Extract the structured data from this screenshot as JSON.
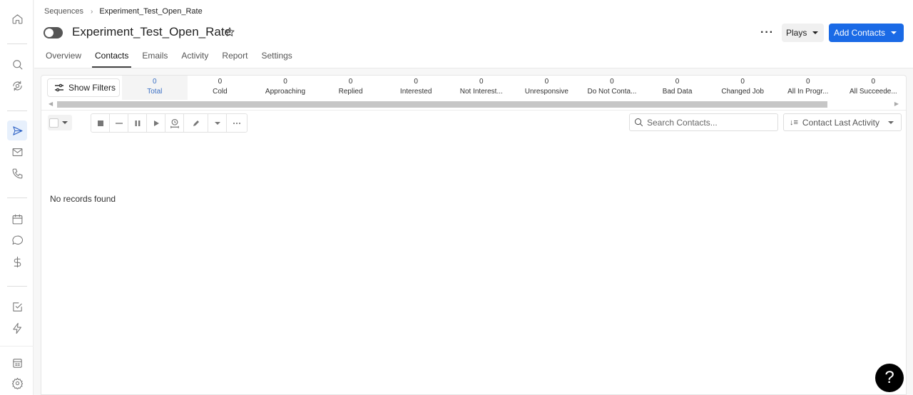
{
  "sidebar": {
    "items": [
      {
        "name": "home",
        "icon": "home-icon"
      },
      {
        "name": "search",
        "icon": "search-icon"
      },
      {
        "name": "sync",
        "icon": "sync-icon"
      },
      {
        "name": "sequences",
        "icon": "send-icon",
        "active": true
      },
      {
        "name": "mail",
        "icon": "mail-icon"
      },
      {
        "name": "phone",
        "icon": "phone-icon"
      },
      {
        "name": "calendar",
        "icon": "calendar-icon"
      },
      {
        "name": "chat",
        "icon": "chat-icon"
      },
      {
        "name": "deals",
        "icon": "dollar-icon"
      },
      {
        "name": "tasks",
        "icon": "checkbox-icon"
      },
      {
        "name": "automation",
        "icon": "lightning-icon"
      },
      {
        "name": "reports",
        "icon": "table-icon"
      },
      {
        "name": "settings",
        "icon": "gear-icon"
      }
    ]
  },
  "breadcrumb": {
    "parent": "Sequences",
    "current": "Experiment_Test_Open_Rate"
  },
  "header": {
    "title": "Experiment_Test_Open_Rate",
    "more_label": "···",
    "plays_label": "Plays",
    "add_contacts_label": "Add Contacts",
    "accent_color": "#1a6ae6"
  },
  "tabs": [
    {
      "label": "Overview",
      "active": false
    },
    {
      "label": "Contacts",
      "active": true
    },
    {
      "label": "Emails",
      "active": false
    },
    {
      "label": "Activity",
      "active": false
    },
    {
      "label": "Report",
      "active": false
    },
    {
      "label": "Settings",
      "active": false
    }
  ],
  "filters": {
    "show_filters_label": "Show Filters"
  },
  "stats": [
    {
      "count": "0",
      "label": "Total",
      "active": true
    },
    {
      "count": "0",
      "label": "Cold"
    },
    {
      "count": "0",
      "label": "Approaching"
    },
    {
      "count": "0",
      "label": "Replied"
    },
    {
      "count": "0",
      "label": "Interested"
    },
    {
      "count": "0",
      "label": "Not Interest..."
    },
    {
      "count": "0",
      "label": "Unresponsive"
    },
    {
      "count": "0",
      "label": "Do Not Conta..."
    },
    {
      "count": "0",
      "label": "Bad Data"
    },
    {
      "count": "0",
      "label": "Changed Job"
    },
    {
      "count": "0",
      "label": "All In Progr..."
    },
    {
      "count": "0",
      "label": "All Succeede..."
    }
  ],
  "toolbar": {
    "search_placeholder": "Search Contacts...",
    "sort_label": "Contact Last Activity",
    "actions": [
      "stop",
      "remove",
      "pause",
      "play",
      "schedule",
      "edit",
      "edit-dropdown",
      "more"
    ]
  },
  "empty_state": "No records found",
  "help_label": "?"
}
